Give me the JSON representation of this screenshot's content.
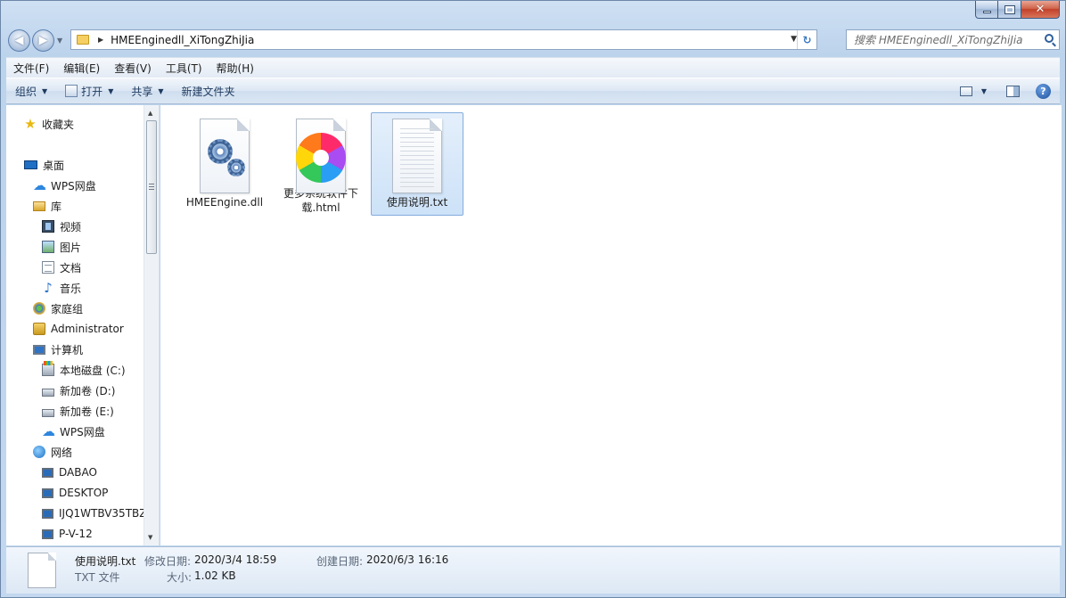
{
  "window": {
    "caption_buttons": {
      "minimize": "—",
      "maximize": "□",
      "close": "✕"
    }
  },
  "nav": {
    "back_glyph": "◀",
    "forward_glyph": "▶",
    "address_path": "HMEEnginedll_XiTongZhiJia",
    "address_sep": "▶",
    "dropdown_glyph": "▼",
    "refresh_glyph": "↻",
    "search_placeholder": "搜索 HMEEnginedll_XiTongZhiJia"
  },
  "menubar": {
    "items": [
      "文件(F)",
      "编辑(E)",
      "查看(V)",
      "工具(T)",
      "帮助(H)"
    ]
  },
  "toolbar": {
    "organize_label": "组织",
    "open_label": "打开",
    "share_label": "共享",
    "new_folder_label": "新建文件夹",
    "caret": "▼",
    "help_glyph": "?"
  },
  "navpane": {
    "items": [
      {
        "label": "收藏夹",
        "icon": "star-icon"
      },
      {
        "label": "桌面",
        "icon": "desktop-icon"
      },
      {
        "label": "WPS网盘",
        "icon": "cloud-icon"
      },
      {
        "label": "库",
        "icon": "library-icon"
      },
      {
        "label": "视频",
        "icon": "video-icon"
      },
      {
        "label": "图片",
        "icon": "picture-icon"
      },
      {
        "label": "文档",
        "icon": "document-icon"
      },
      {
        "label": "音乐",
        "icon": "music-icon"
      },
      {
        "label": "家庭组",
        "icon": "homegroup-icon"
      },
      {
        "label": "Administrator",
        "icon": "user-folder-icon"
      },
      {
        "label": "计算机",
        "icon": "computer-icon"
      },
      {
        "label": "本地磁盘 (C:)",
        "icon": "drive-c-icon"
      },
      {
        "label": "新加卷 (D:)",
        "icon": "drive-icon"
      },
      {
        "label": "新加卷 (E:)",
        "icon": "drive-icon"
      },
      {
        "label": "WPS网盘",
        "icon": "cloud-icon"
      },
      {
        "label": "网络",
        "icon": "network-icon"
      },
      {
        "label": "DABAO",
        "icon": "pc-icon"
      },
      {
        "label": "DESKTOP",
        "icon": "pc-icon"
      },
      {
        "label": "IJQ1WTBV35TBZ",
        "icon": "pc-icon"
      },
      {
        "label": "P-V-12",
        "icon": "pc-icon"
      }
    ],
    "star_glyph": "★",
    "cloud_glyph": "☁",
    "music_glyph": "♪",
    "scroll_up": "▲",
    "scroll_down": "▼"
  },
  "files": [
    {
      "name": "HMEEngine.dll",
      "icon": "dll-gear-icon",
      "selected": false
    },
    {
      "name": "更多系统软件下载.html",
      "icon": "browser-html-icon",
      "selected": false
    },
    {
      "name": "使用说明.txt",
      "icon": "text-file-icon",
      "selected": true
    }
  ],
  "details": {
    "file_name": "使用说明.txt",
    "file_type": "TXT 文件",
    "modified_key": "修改日期:",
    "modified_val": "2020/3/4 18:59",
    "size_key": "大小:",
    "size_val": "1.02 KB",
    "created_key": "创建日期:",
    "created_val": "2020/6/3 16:16"
  },
  "colors": {
    "selection_bg": "#cde2f8",
    "selection_border": "#84acdd",
    "chrome": "#c6d9ee"
  }
}
